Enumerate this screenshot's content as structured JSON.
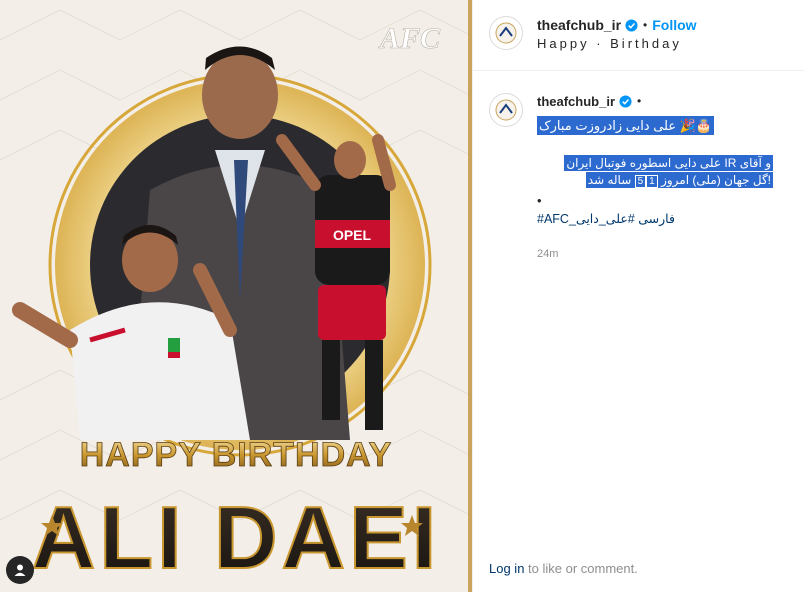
{
  "post": {
    "username": "theafchub_ir",
    "follow_label": "Follow",
    "location": "Happy · Birthday",
    "caption": {
      "line1": "علی دایی زادروزت مبارک",
      "line1_emoji": "🎂🎉",
      "line2a": "و آقای IR علی دایی اسطوره فوتبال ایران",
      "line2b": "!گل جهان (ملی) امروز ",
      "line2_num1": "5",
      "line2_num2": "1",
      "line2c": " ساله شد",
      "bullet": "•",
      "tags": "فارسی #علی_دایی_AFC#"
    },
    "time": "24m",
    "login_link": "Log in",
    "login_text": " to like or comment."
  },
  "media": {
    "logo": "AFC",
    "headline1": "HAPPY BIRTHDAY",
    "headline2": "ALI DAEI",
    "jersey_sponsor": "OPEL"
  },
  "icons": {
    "verified": "verified-badge-icon",
    "info": "user-tag-icon"
  }
}
